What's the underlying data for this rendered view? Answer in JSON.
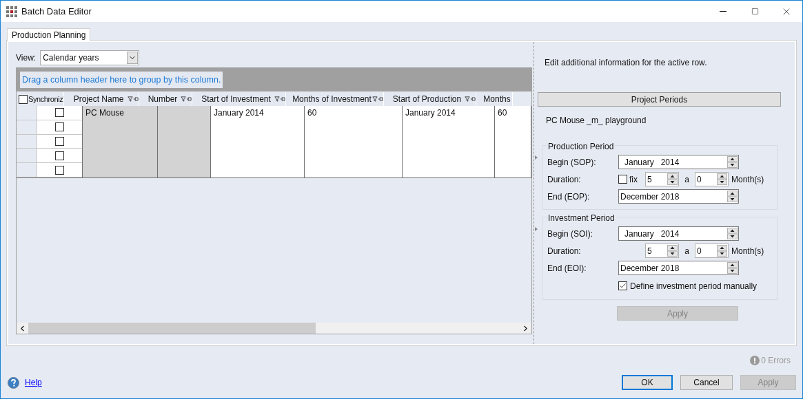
{
  "window": {
    "title": "Batch Data Editor"
  },
  "tabs": [
    {
      "label": "Production Planning",
      "selected": true
    }
  ],
  "view": {
    "label": "View:",
    "value": "Calendar years"
  },
  "grid": {
    "group_hint": "Drag a column header here to group by this column.",
    "select_all_checked": false,
    "columns": [
      {
        "label": "Synchroniz"
      },
      {
        "label": "Project Name"
      },
      {
        "label": "Number"
      },
      {
        "label": "Start of Investment"
      },
      {
        "label": "Months of Investment"
      },
      {
        "label": "Start of Production"
      },
      {
        "label": "Months"
      }
    ],
    "sync_checks": [
      {
        "checked": false
      },
      {
        "checked": false
      },
      {
        "checked": false
      },
      {
        "checked": false
      },
      {
        "checked": false
      }
    ],
    "cells": [
      {
        "text": "PC Mouse",
        "readonly": true
      },
      {
        "readonly": true
      },
      {
        "text": "January 2014",
        "readonly": false
      },
      {
        "text": "60",
        "readonly": false
      },
      {
        "text": "January 2014",
        "readonly": false
      },
      {
        "text": "60",
        "readonly": false
      }
    ]
  },
  "details": {
    "info_text": "Edit additional information for the active row.",
    "section_button": "Project Periods",
    "project_label": "PC Mouse _m_ playground",
    "production_period": {
      "title": "Production Period",
      "begin": {
        "label": "Begin (SOP):",
        "value": "January   2014"
      },
      "duration": {
        "label": "Duration:",
        "fix": {
          "label": "fix",
          "checked": false
        },
        "years": "5",
        "years_unit": "a",
        "months": "0",
        "months_unit": "Month(s)"
      },
      "end": {
        "label": "End (EOP):",
        "value": "December 2018"
      }
    },
    "investment_period": {
      "title": "Investment Period",
      "begin": {
        "label": "Begin (SOI):",
        "value": "January   2014"
      },
      "duration": {
        "label": "Duration:",
        "years": "5",
        "years_unit": "a",
        "months": "0",
        "months_unit": "Month(s)"
      },
      "end": {
        "label": "End (EOI):",
        "value": "December 2018"
      },
      "manual": {
        "label": "Define investment period manually",
        "checked": true
      }
    },
    "apply_button": {
      "label": "Apply",
      "disabled": true
    }
  },
  "footer": {
    "errors": "0 Errors",
    "help": "Help",
    "buttons": [
      {
        "label": "OK",
        "default": true,
        "disabled": false
      },
      {
        "label": "Cancel",
        "default": false,
        "disabled": false
      },
      {
        "label": "Apply",
        "default": false,
        "disabled": true
      }
    ]
  }
}
